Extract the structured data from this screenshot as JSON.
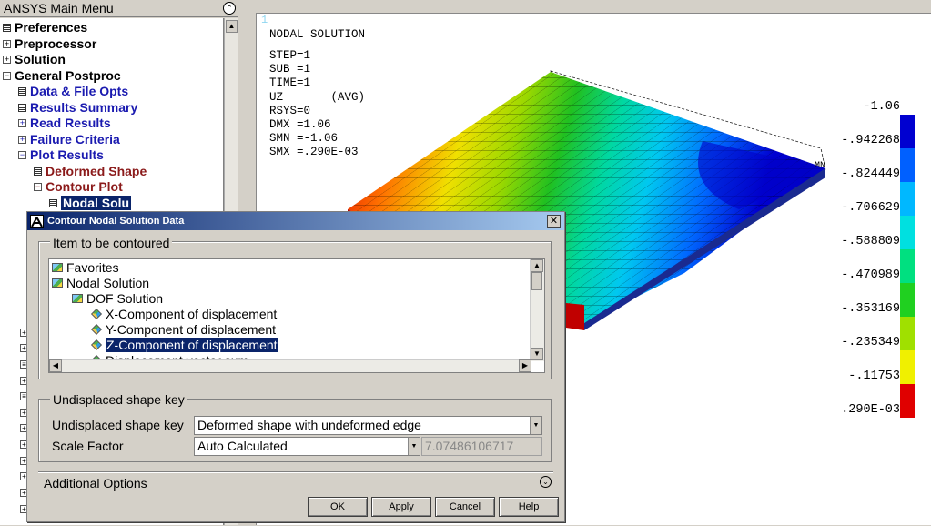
{
  "menu": {
    "title": "ANSYS Main Menu",
    "items": [
      {
        "label": "Preferences"
      },
      {
        "label": "Preprocessor"
      },
      {
        "label": "Solution"
      },
      {
        "label": "General Postproc"
      },
      {
        "label": "Data & File Opts"
      },
      {
        "label": "Results Summary"
      },
      {
        "label": "Read Results"
      },
      {
        "label": "Failure Criteria"
      },
      {
        "label": "Plot Results"
      },
      {
        "label": "Deformed Shape"
      },
      {
        "label": "Contour Plot"
      },
      {
        "label": "Nodal Solu"
      }
    ]
  },
  "graphics": {
    "window_number": "1",
    "info_lines": [
      "NODAL SOLUTION",
      "STEP=1",
      "SUB =1",
      "TIME=1",
      "UZ       (AVG)",
      "RSYS=0",
      "DMX =1.06",
      "SMN =-1.06",
      "SMX =.290E-03"
    ],
    "mn_label": "MN",
    "legend": [
      {
        "value": "-1.06",
        "color": "#0000d0"
      },
      {
        "value": "-.942268",
        "color": "#0060ff"
      },
      {
        "value": "-.824449",
        "color": "#00b8ff"
      },
      {
        "value": "-.706629",
        "color": "#00e0e0"
      },
      {
        "value": "-.588809",
        "color": "#00e080"
      },
      {
        "value": "-.470989",
        "color": "#20d020"
      },
      {
        "value": "-.353169",
        "color": "#a0e000"
      },
      {
        "value": "-.235349",
        "color": "#f0f000"
      },
      {
        "value": "-.11753",
        "color": "#ff9000"
      },
      {
        "value": ".290E-03",
        "color": "#e00000"
      }
    ]
  },
  "dialog": {
    "title": "Contour Nodal Solution Data",
    "item_group_label": "Item to be contoured",
    "tree": [
      {
        "label": "Favorites",
        "icon": "folder-icon"
      },
      {
        "label": "Nodal Solution",
        "icon": "folder-icon"
      },
      {
        "label": "DOF Solution",
        "icon": "folder-icon"
      },
      {
        "label": "X-Component of displacement",
        "icon": "cube-icon"
      },
      {
        "label": "Y-Component of displacement",
        "icon": "cube-icon"
      },
      {
        "label": "Z-Component of displacement",
        "icon": "cube-icon"
      },
      {
        "label": "Displacement vector sum",
        "icon": "cube-icon"
      }
    ],
    "undisplaced_group_label": "Undisplaced shape key",
    "undisplaced_label": "Undisplaced shape key",
    "undisplaced_value": "Deformed shape with undeformed edge",
    "scale_label": "Scale Factor",
    "scale_value": "Auto Calculated",
    "scale_number": "7.07486106717",
    "additional_options": "Additional Options",
    "buttons": {
      "ok": "OK",
      "apply": "Apply",
      "cancel": "Cancel",
      "help": "Help"
    }
  }
}
